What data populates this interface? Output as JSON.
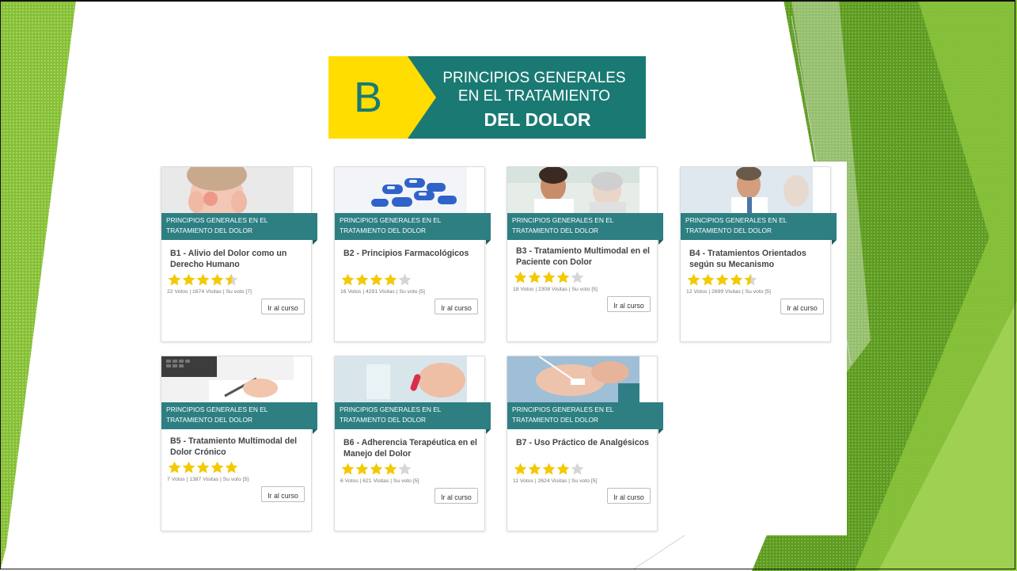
{
  "banner": {
    "letter": "B",
    "line1": "PRINCIPIOS GENERALES",
    "line2": "EN EL TRATAMIENTO",
    "line3": "DEL DOLOR"
  },
  "colors": {
    "green": "#8cc43c",
    "dark_green": "#5f9f22",
    "teal": "#2d7f82",
    "banner_teal": "#1a7a73",
    "yellow": "#ffdd00",
    "star": "#f3c900"
  },
  "cards": [
    {
      "ribbon": "PRINCIPIOS GENERALES EN EL TRATAMIENTO DEL DOLOR",
      "title": "B1 - Alivio del Dolor como un Derecho Humano",
      "rating": 4.5,
      "meta": "22 Votos | 1674 Visitas | Su voto [7]",
      "button": "Ir al curso",
      "image": "woman-headache-photo"
    },
    {
      "ribbon": "PRINCIPIOS GENERALES EN EL TRATAMIENTO DEL DOLOR",
      "title": "B2 - Principios Farmacológicos",
      "rating": 4,
      "meta": "16 Votos | 4291 Visitas | Su voto [5]",
      "button": "Ir al curso",
      "image": "blue-pills-photo"
    },
    {
      "ribbon": "PRINCIPIOS GENERALES EN EL TRATAMIENTO DEL DOLOR",
      "title": "B3 - Tratamiento Multimodal en el Paciente con Dolor",
      "rating": 4,
      "meta": "18 Votos | 2308 Visitas | Su voto [5]",
      "button": "Ir al curso",
      "image": "nurse-patient-photo"
    },
    {
      "ribbon": "PRINCIPIOS GENERALES EN EL TRATAMIENTO DEL DOLOR",
      "title": "B4 - Tratamientos Orientados según su Mecanismo",
      "rating": 4.5,
      "meta": "12 Votos | 2699 Visitas | Su voto [5]",
      "button": "Ir al curso",
      "image": "doctor-photo"
    },
    {
      "ribbon": "PRINCIPIOS GENERALES EN EL TRATAMIENTO DEL DOLOR",
      "title": "B5 - Tratamiento Multimodal del Dolor Crónico",
      "rating": 5,
      "meta": "7 Votos | 1387 Visitas | Su voto [5]",
      "button": "Ir al curso",
      "image": "laptop-writing-photo"
    },
    {
      "ribbon": "PRINCIPIOS GENERALES EN EL TRATAMIENTO DEL DOLOR",
      "title": "B6 - Adherencia Terapéutica en el Manejo del Dolor",
      "rating": 4,
      "meta": "6 Votos | 621 Visitas | Su voto [5]",
      "button": "Ir al curso",
      "image": "pill-in-hand-photo"
    },
    {
      "ribbon": "PRINCIPIOS GENERALES EN EL TRATAMIENTO DEL DOLOR",
      "title": "B7 - Uso Práctico de Analgésicos",
      "rating": 4,
      "meta": "11 Votos | 2624 Visitas | Su voto [5]",
      "button": "Ir al curso",
      "image": "iv-drip-hand-photo"
    }
  ]
}
